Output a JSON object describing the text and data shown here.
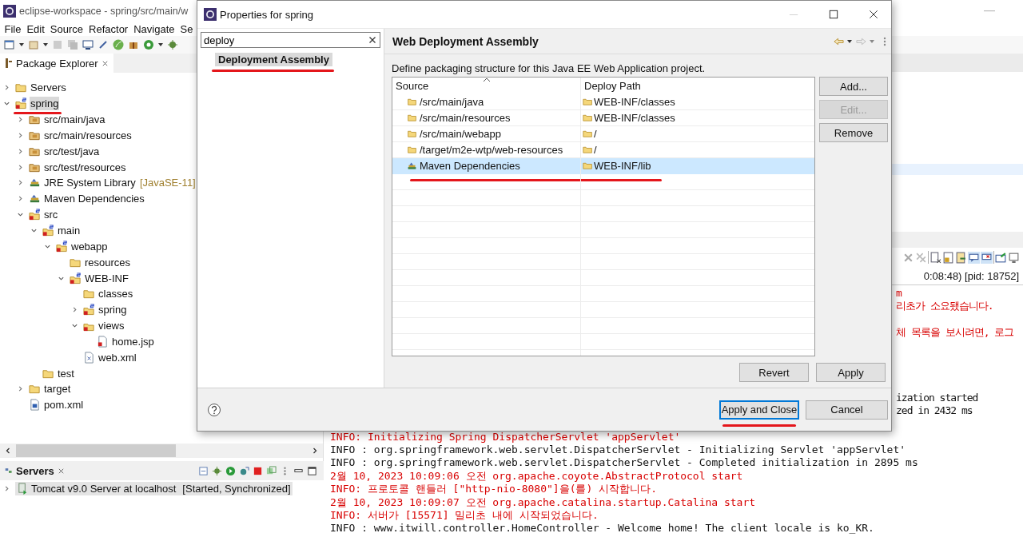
{
  "window": {
    "title": "eclipse-workspace - spring/src/main/w"
  },
  "menu": [
    "File",
    "Edit",
    "Source",
    "Refactor",
    "Navigate",
    "Se"
  ],
  "package_explorer": {
    "title": "Package Explorer",
    "tree": [
      {
        "label": "Servers",
        "kind": "folder",
        "expanded": false,
        "selected": false
      },
      {
        "label": "spring",
        "kind": "project",
        "expanded": true,
        "selected": true,
        "annotated": true,
        "children": [
          {
            "label": "src/main/java",
            "kind": "source-folder",
            "expanded": false,
            "selected": false
          },
          {
            "label": "src/main/resources",
            "kind": "source-folder",
            "expanded": false,
            "selected": false
          },
          {
            "label": "src/test/java",
            "kind": "source-folder",
            "expanded": false,
            "selected": false
          },
          {
            "label": "src/test/resources",
            "kind": "source-folder",
            "expanded": false,
            "selected": false
          },
          {
            "label": "JRE System Library",
            "decoration": "[JavaSE-11]",
            "kind": "library",
            "expanded": false,
            "selected": false
          },
          {
            "label": "Maven Dependencies",
            "kind": "library",
            "expanded": false,
            "selected": false
          },
          {
            "label": "src",
            "kind": "project",
            "expanded": true,
            "selected": false,
            "children": [
              {
                "label": "main",
                "kind": "project",
                "expanded": true,
                "selected": false,
                "children": [
                  {
                    "label": "webapp",
                    "kind": "project",
                    "expanded": true,
                    "selected": false,
                    "children": [
                      {
                        "label": "resources",
                        "kind": "folder",
                        "selected": false
                      },
                      {
                        "label": "WEB-INF",
                        "kind": "project",
                        "expanded": true,
                        "selected": false,
                        "children": [
                          {
                            "label": "classes",
                            "kind": "folder",
                            "selected": false
                          },
                          {
                            "label": "spring",
                            "kind": "spring-folder",
                            "expanded": false,
                            "selected": false
                          },
                          {
                            "label": "views",
                            "kind": "error-folder",
                            "expanded": true,
                            "selected": false,
                            "children": [
                              {
                                "label": "home.jsp",
                                "kind": "jsp",
                                "selected": false
                              }
                            ]
                          },
                          {
                            "label": "web.xml",
                            "kind": "xml",
                            "selected": false
                          }
                        ]
                      }
                    ]
                  }
                ]
              },
              {
                "label": "test",
                "kind": "folder",
                "selected": false
              }
            ]
          },
          {
            "label": "target",
            "kind": "folder",
            "expanded": false,
            "selected": false
          },
          {
            "label": "pom.xml",
            "kind": "pom",
            "selected": false
          }
        ]
      }
    ]
  },
  "servers_view": {
    "title": "Servers",
    "servers": [
      {
        "name": "Tomcat v9.0 Server at localhost",
        "status": "[Started, Synchronized]",
        "expanded": false,
        "selected": true
      }
    ]
  },
  "console": {
    "header": "0:08:48) [pid: 18752]",
    "lines": [
      {
        "text": "m",
        "kind": "error",
        "hidden_start": true
      },
      {
        "text": "리초가 소요됐습니다.",
        "kind": "error",
        "hidden_start": true
      },
      {
        "text": "체 목록을 보시려면, 로그",
        "kind": "error",
        "hidden_start": true
      },
      {
        "text": "ization started",
        "kind": "info",
        "hidden_start": true
      },
      {
        "text": "zed in 2432 ms",
        "kind": "info",
        "hidden_start": true
      },
      {
        "text": "INFO: Initializing Spring DispatcherServlet 'appServlet'",
        "kind": "error",
        "hidden_start": false
      },
      {
        "text": "INFO : org.springframework.web.servlet.DispatcherServlet - Initializing Servlet 'appServlet'",
        "kind": "info",
        "hidden_start": false
      },
      {
        "text": "INFO : org.springframework.web.servlet.DispatcherServlet - Completed initialization in 2895 ms",
        "kind": "info",
        "hidden_start": false
      },
      {
        "text": "2월 10, 2023 10:09:06 오전 org.apache.coyote.AbstractProtocol start",
        "kind": "error",
        "hidden_start": false
      },
      {
        "text": "INFO: 프로토콜 핸들러 [\"http-nio-8080\"]을(를) 시작합니다.",
        "kind": "error",
        "hidden_start": false
      },
      {
        "text": "2월 10, 2023 10:09:07 오전 org.apache.catalina.startup.Catalina start",
        "kind": "error",
        "hidden_start": false
      },
      {
        "text": "INFO: 서버가 [15571] 밀리초 내에 시작되었습니다.",
        "kind": "error",
        "hidden_start": false
      },
      {
        "text": "INFO : www.itwill.controller.HomeController - Welcome home! The client locale is ko_KR.",
        "kind": "info",
        "hidden_start": false
      }
    ]
  },
  "dialog": {
    "title": "Properties for spring",
    "filter": {
      "value": "deploy"
    },
    "pages": [
      {
        "label": "Deployment Assembly",
        "selected": true,
        "annotated": true
      }
    ],
    "page_title": "Web Deployment Assembly",
    "description": "Define packaging structure for this Java EE Web Application project.",
    "table": {
      "columns": [
        "Source",
        "Deploy Path"
      ],
      "rows": [
        {
          "source": "/src/main/java",
          "deploy_path": "WEB-INF/classes",
          "kind": "folder",
          "selected": false,
          "annotated": false
        },
        {
          "source": "/src/main/resources",
          "deploy_path": "WEB-INF/classes",
          "kind": "folder",
          "selected": false,
          "annotated": false
        },
        {
          "source": "/src/main/webapp",
          "deploy_path": "/",
          "kind": "folder",
          "selected": false,
          "annotated": false
        },
        {
          "source": "/target/m2e-wtp/web-resources",
          "deploy_path": "/",
          "kind": "folder",
          "selected": false,
          "annotated": false
        },
        {
          "source": "Maven Dependencies",
          "deploy_path": "WEB-INF/lib",
          "kind": "library",
          "selected": true,
          "annotated": true
        }
      ]
    },
    "side_buttons": [
      {
        "label": "Add...",
        "disabled": false
      },
      {
        "label": "Edit...",
        "disabled": true
      },
      {
        "label": "Remove",
        "disabled": false
      }
    ],
    "page_buttons": [
      "Revert",
      "Apply"
    ],
    "footer_buttons": [
      {
        "label": "Apply and Close",
        "default": true,
        "annotated": true
      },
      {
        "label": "Cancel",
        "default": false,
        "annotated": false
      }
    ]
  }
}
